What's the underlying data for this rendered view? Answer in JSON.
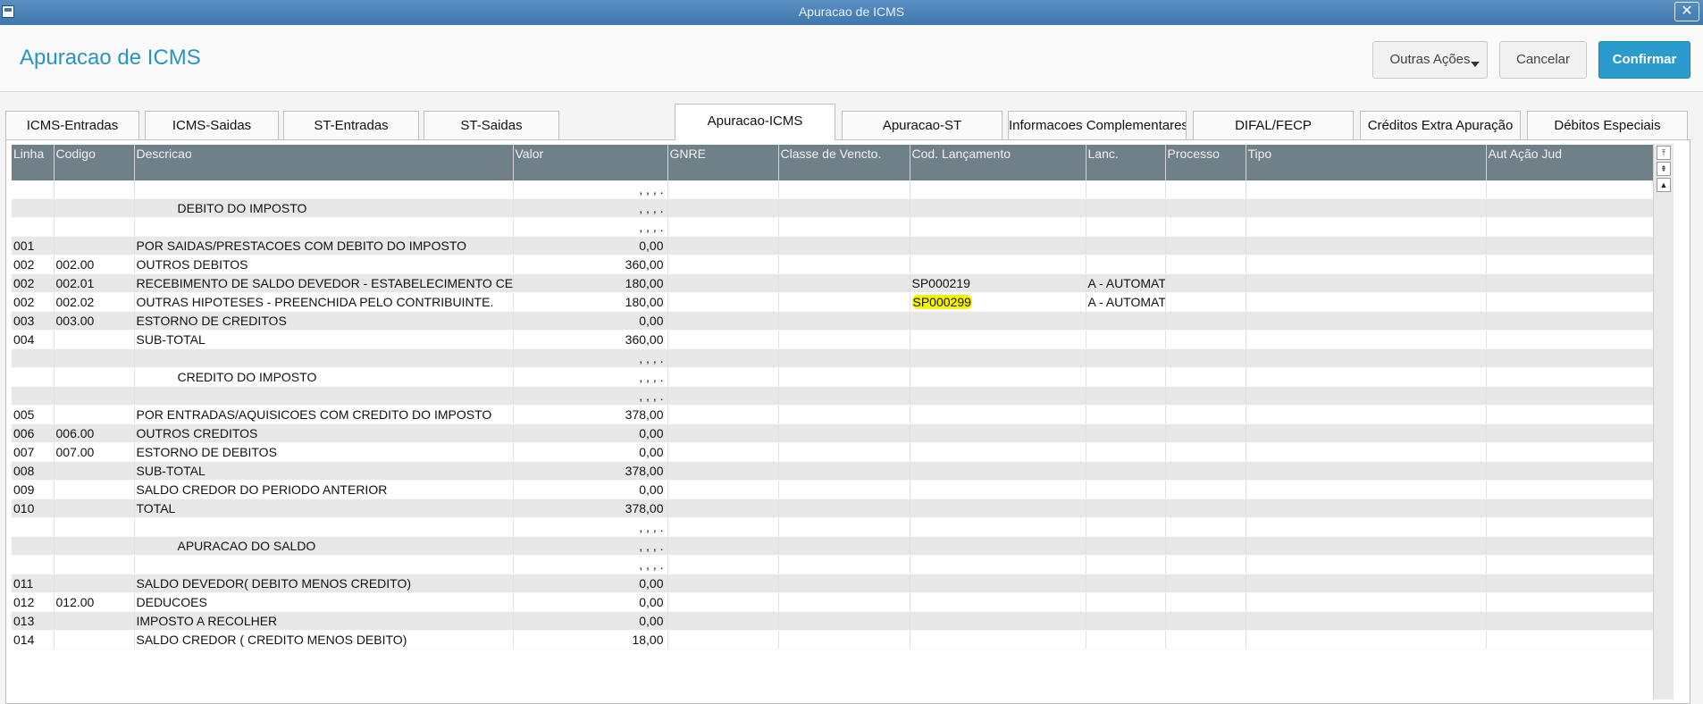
{
  "window": {
    "title": "Apuracao de ICMS",
    "close_label": "✕"
  },
  "header": {
    "page_title": "Apuracao de ICMS",
    "buttons": {
      "outras": "Outras Ações",
      "cancelar": "Cancelar",
      "confirmar": "Confirmar"
    }
  },
  "tabs": [
    "ICMS-Entradas",
    "ICMS-Saidas",
    "ST-Entradas",
    "ST-Saidas",
    "Apuracao-ICMS",
    "Apuracao-ST",
    "Informacoes Complementares",
    "DIFAL/FECP",
    "Créditos Extra Apuração",
    "Débitos Especiais"
  ],
  "active_tab": "Apuracao-ICMS",
  "grid": {
    "columns": [
      "Linha",
      "Codigo",
      "Descricao",
      "Valor",
      "GNRE",
      "Classe de Vencto.",
      "Cod. Lançamento",
      "Lanc.",
      "Processo",
      "Tipo",
      "Aut Ação Jud"
    ],
    "highlight_color": "#f7f400",
    "rows": [
      {
        "linha": "",
        "codigo": "",
        "descricao": "",
        "valor": ", , , .",
        "cod": "",
        "lanc": ""
      },
      {
        "linha": "",
        "codigo": "",
        "descricao": "DEBITO DO IMPOSTO",
        "valor": ", , , .",
        "cod": "",
        "lanc": ""
      },
      {
        "linha": "",
        "codigo": "",
        "descricao": "",
        "valor": ", , , .",
        "cod": "",
        "lanc": ""
      },
      {
        "linha": "001",
        "codigo": "",
        "descricao": "POR SAIDAS/PRESTACOES COM DEBITO DO IMPOSTO",
        "valor": "0,00",
        "cod": "",
        "lanc": ""
      },
      {
        "linha": "002",
        "codigo": "002.00",
        "descricao": "OUTROS DEBITOS",
        "valor": "360,00",
        "cod": "",
        "lanc": ""
      },
      {
        "linha": "002",
        "codigo": "002.01",
        "descricao": "RECEBIMENTO DE SALDO DEVEDOR - ESTABELECIMENTO CEN",
        "valor": "180,00",
        "cod": "SP000219",
        "lanc": "A  - AUTOMAT"
      },
      {
        "linha": "002",
        "codigo": "002.02",
        "descricao": "OUTRAS HIPOTESES - PREENCHIDA PELO CONTRIBUINTE.",
        "valor": "180,00",
        "cod": "SP000299",
        "lanc": "A  - AUTOMAT",
        "highlight": true
      },
      {
        "linha": "003",
        "codigo": "003.00",
        "descricao": "ESTORNO DE CREDITOS",
        "valor": "0,00",
        "cod": "",
        "lanc": ""
      },
      {
        "linha": "004",
        "codigo": "",
        "descricao": "SUB-TOTAL",
        "valor": "360,00",
        "cod": "",
        "lanc": ""
      },
      {
        "linha": "",
        "codigo": "",
        "descricao": "",
        "valor": ", , , .",
        "cod": "",
        "lanc": ""
      },
      {
        "linha": "",
        "codigo": "",
        "descricao": "CREDITO DO IMPOSTO",
        "valor": ", , , .",
        "cod": "",
        "lanc": ""
      },
      {
        "linha": "",
        "codigo": "",
        "descricao": "",
        "valor": ", , , .",
        "cod": "",
        "lanc": ""
      },
      {
        "linha": "005",
        "codigo": "",
        "descricao": "POR ENTRADAS/AQUISICOES COM CREDITO DO IMPOSTO",
        "valor": "378,00",
        "cod": "",
        "lanc": ""
      },
      {
        "linha": "006",
        "codigo": "006.00",
        "descricao": "OUTROS CREDITOS",
        "valor": "0,00",
        "cod": "",
        "lanc": ""
      },
      {
        "linha": "007",
        "codigo": "007.00",
        "descricao": "ESTORNO DE DEBITOS",
        "valor": "0,00",
        "cod": "",
        "lanc": ""
      },
      {
        "linha": "008",
        "codigo": "",
        "descricao": "SUB-TOTAL",
        "valor": "378,00",
        "cod": "",
        "lanc": ""
      },
      {
        "linha": "009",
        "codigo": "",
        "descricao": "SALDO CREDOR DO PERIODO ANTERIOR",
        "valor": "0,00",
        "cod": "",
        "lanc": ""
      },
      {
        "linha": "010",
        "codigo": "",
        "descricao": "TOTAL",
        "valor": "378,00",
        "cod": "",
        "lanc": ""
      },
      {
        "linha": "",
        "codigo": "",
        "descricao": "",
        "valor": ", , , .",
        "cod": "",
        "lanc": ""
      },
      {
        "linha": "",
        "codigo": "",
        "descricao": "APURACAO DO SALDO",
        "valor": ", , , .",
        "cod": "",
        "lanc": ""
      },
      {
        "linha": "",
        "codigo": "",
        "descricao": "",
        "valor": ", , , .",
        "cod": "",
        "lanc": ""
      },
      {
        "linha": "011",
        "codigo": "",
        "descricao": "SALDO DEVEDOR( DEBITO MENOS CREDITO)",
        "valor": "0,00",
        "cod": "",
        "lanc": ""
      },
      {
        "linha": "012",
        "codigo": "012.00",
        "descricao": "DEDUCOES",
        "valor": "0,00",
        "cod": "",
        "lanc": ""
      },
      {
        "linha": "013",
        "codigo": "",
        "descricao": "IMPOSTO A RECOLHER",
        "valor": "0,00",
        "cod": "",
        "lanc": ""
      },
      {
        "linha": "014",
        "codigo": "",
        "descricao": "SALDO CREDOR ( CREDITO MENOS DEBITO)",
        "valor": "18,00",
        "cod": "",
        "lanc": ""
      }
    ]
  }
}
